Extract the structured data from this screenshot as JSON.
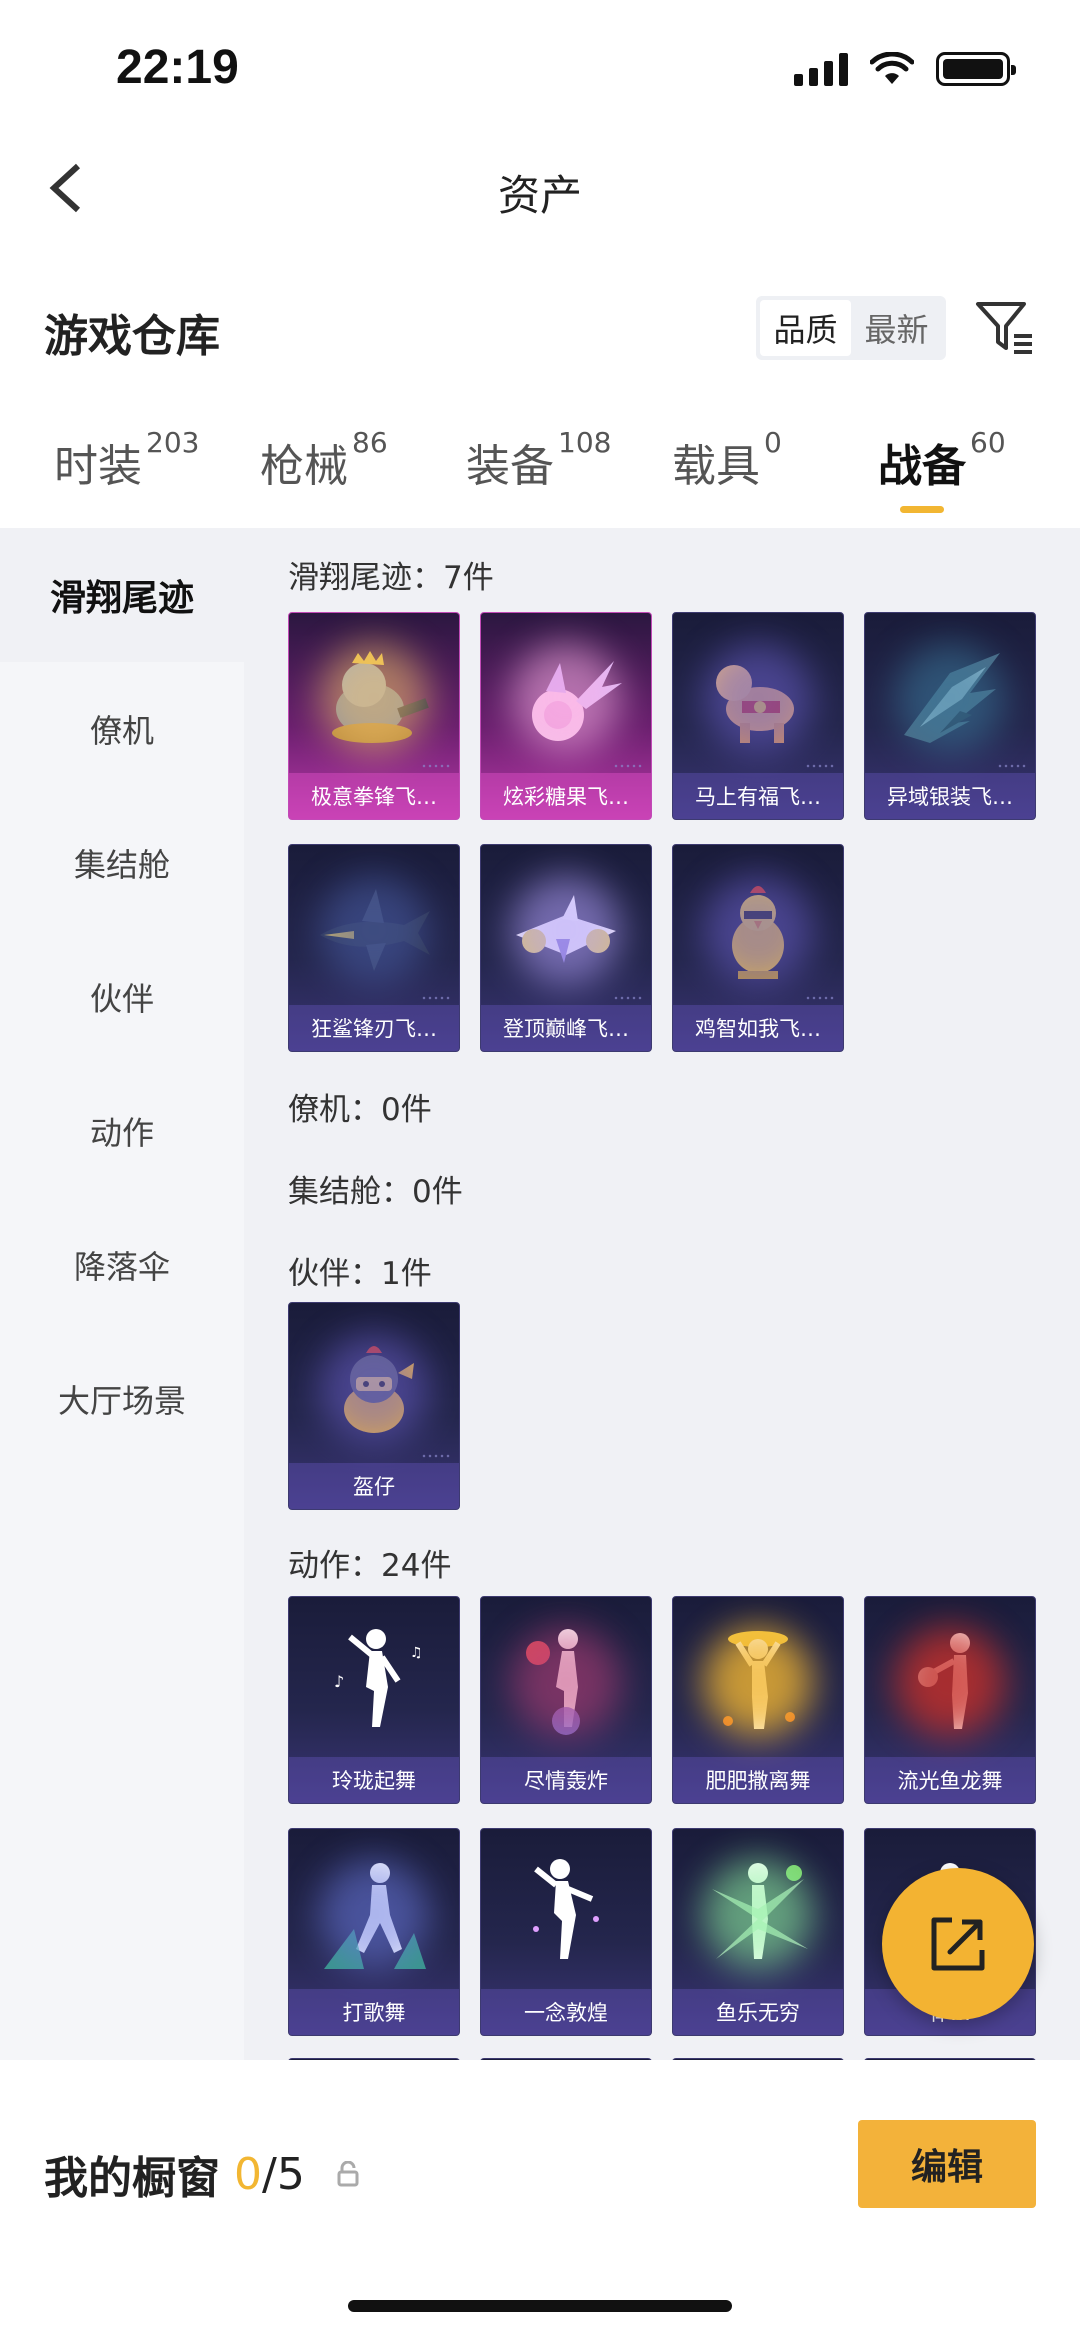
{
  "status_bar": {
    "time": "22:19"
  },
  "nav": {
    "title": "资产"
  },
  "warehouse": {
    "title": "游戏仓库",
    "sort_options": [
      "品质",
      "最新"
    ],
    "sort_active": "品质"
  },
  "tabs": [
    {
      "label": "时装",
      "count": "203"
    },
    {
      "label": "枪械",
      "count": "86"
    },
    {
      "label": "装备",
      "count": "108"
    },
    {
      "label": "载具",
      "count": "0"
    },
    {
      "label": "战备",
      "count": "60",
      "active": true
    }
  ],
  "sidebar": {
    "items": [
      "滑翔尾迹",
      "僚机",
      "集结舱",
      "伙伴",
      "动作",
      "降落伞",
      "大厅场景"
    ],
    "active": "滑翔尾迹"
  },
  "sections": {
    "glide_trail": {
      "label": "滑翔尾迹：7件"
    },
    "wingman": {
      "label": "僚机：0件"
    },
    "capsule": {
      "label": "集结舱：0件"
    },
    "partner": {
      "label": "伙伴：1件"
    },
    "emote": {
      "label": "动作：24件"
    }
  },
  "items": {
    "glide_trail": [
      "极意拳锋飞…",
      "炫彩糖果飞…",
      "马上有福飞…",
      "异域银装飞…",
      "狂鲨锋刃飞…",
      "登顶巅峰飞…",
      "鸡智如我飞…"
    ],
    "partner": [
      "盔仔"
    ],
    "emote": [
      "玲珑起舞",
      "尽情轰炸",
      "肥肥撒离舞",
      "流光鱼龙舞",
      "打歌舞",
      "一念敦煌",
      "鱼乐无穷",
      "律…"
    ]
  },
  "showcase": {
    "label": "我的橱窗",
    "current": "0",
    "separator": "/",
    "max": "5",
    "edit_label": "编辑"
  },
  "colors": {
    "accent": "#f2b632",
    "card_dark": "#24264d",
    "card_pink": "#b838a8"
  }
}
